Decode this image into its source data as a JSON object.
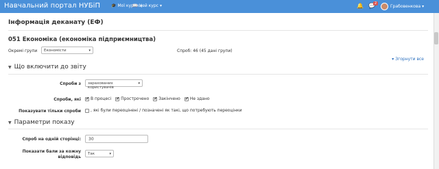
{
  "navbar": {
    "brand": "Навчальний портал НУБіП",
    "menu": [
      {
        "icon": "graduation-cap-icon",
        "glyph": "🎓",
        "label": "Мої курси"
      },
      {
        "icon": "book-icon",
        "glyph": "📖",
        "label": "Цей курс"
      }
    ],
    "notifications_count": "2",
    "user_name": "Грабовенкова"
  },
  "page": {
    "title": "Інформація деканату (ЕФ)",
    "course": "051 Економіка (економіка підприємництва)",
    "groups_label": "Окремі групи",
    "groups_value": "Економісти",
    "attempts_text": "Спроб: 46 (45 дані групи)",
    "collapse_all": "Згорнути все"
  },
  "report_section": {
    "heading": "Що включити до звіту",
    "attempts_from_label": "Спроби з",
    "attempts_from_value": "зарахованих користувачів",
    "attempts_that_label": "Спроби, які",
    "states": [
      {
        "label": "В процесі",
        "checked": true
      },
      {
        "label": "Прострочено",
        "checked": true
      },
      {
        "label": "Закінчено",
        "checked": true
      },
      {
        "label": "Не здано",
        "checked": true
      }
    ],
    "show_only_label": "Показувати тільки спроби",
    "show_only_text": ", які були переоцінені / позначені як такі, що потребують переоцінки",
    "show_only_checked": false
  },
  "display_section": {
    "heading": "Параметри показу",
    "per_page_label": "Спроб на одній сторінці:",
    "per_page_value": "30",
    "show_marks_label_line1": "Показати бали за кожну",
    "show_marks_label_line2": "відповідь",
    "show_marks_value": "Так"
  }
}
